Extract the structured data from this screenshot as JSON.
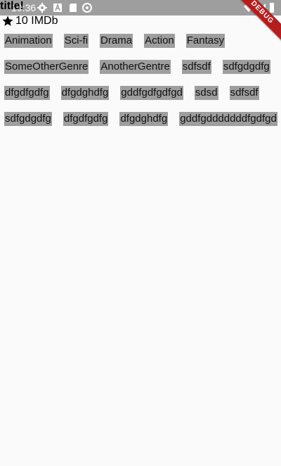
{
  "status_bar": {
    "time": "10:36",
    "icons": [
      "gear-icon",
      "a-icon",
      "sd-card-icon",
      "sync-icon",
      "wifi-icon",
      "cell-signal-icon",
      "battery-icon"
    ],
    "color": "#9e9e9e"
  },
  "debug_ribbon": {
    "label": "DEBUG",
    "color": "#b71c1c"
  },
  "title": "title!",
  "rating": {
    "icon": "star-icon",
    "text": "10 IMDb"
  },
  "genres": [
    "Animation",
    "Sci-fi",
    "Drama",
    "Action",
    "Fantasy",
    "SomeOtherGenre",
    "AnotherGentre",
    "sdfsdf",
    "sdfgdgdfg",
    "dfgdfgdfg",
    "dfgdghdfg",
    "gddfgdfgdfgd",
    "sdsd",
    "sdfsdf",
    "sdfgdgdfg",
    "dfgdfgdfg",
    "dfgdghdfg",
    "gddfgdddddddfgdfgd"
  ],
  "chip_color": "#9e9e9e"
}
